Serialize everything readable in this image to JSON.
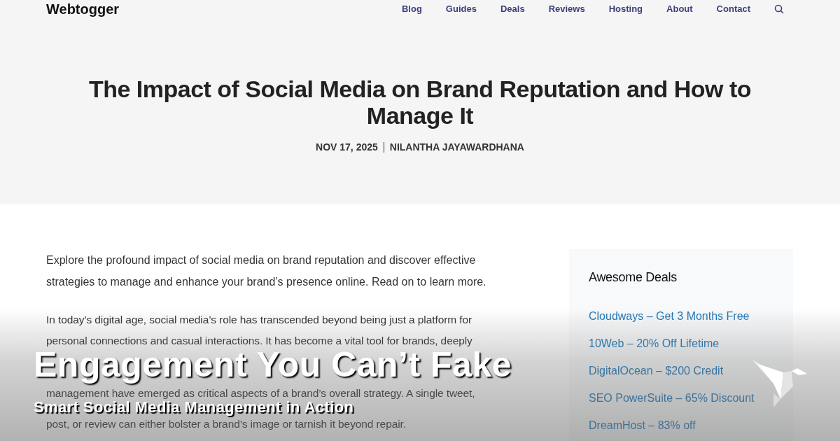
{
  "site": {
    "logo": "Webtogger",
    "nav": [
      "Blog",
      "Guides",
      "Deals",
      "Reviews",
      "Hosting",
      "About",
      "Contact"
    ]
  },
  "post": {
    "title": "The Impact of Social Media on Brand Reputation and How to Manage It",
    "date": "NOV 17, 2025",
    "author": "NILANTHA JAYAWARDHANA",
    "intro": "Explore the profound impact of social media on brand reputation and discover effective strategies to manage and enhance your brand’s presence online. Read on to learn more.",
    "lines": [
      {
        "kind": "line",
        "text": "In today’s digital age, social media’s role has transcended beyond being just a platform for"
      },
      {
        "kind": "line",
        "text": "personal connections and casual interactions. It has become a vital tool for brands, deeply"
      },
      {
        "kind": "resumed",
        "text": "management have emerged as critical aspects of a brand’s overall strategy. A single tweet,"
      },
      {
        "kind": "below",
        "text": "post, or review can either bolster a brand’s image or tarnish it beyond repair."
      }
    ]
  },
  "sidebar": {
    "title": "Awesome Deals",
    "links": [
      "Cloudways – Get 3 Months Free",
      "10Web – 20% Off Lifetime",
      "DigitalOcean – $200 Credit",
      "SEO PowerSuite – 65% Discount",
      "DreamHost – 83% off"
    ]
  },
  "overlay": {
    "headline": "Engagement You Can’t Fake",
    "subtitle": "Smart Social Media Management in Action"
  }
}
